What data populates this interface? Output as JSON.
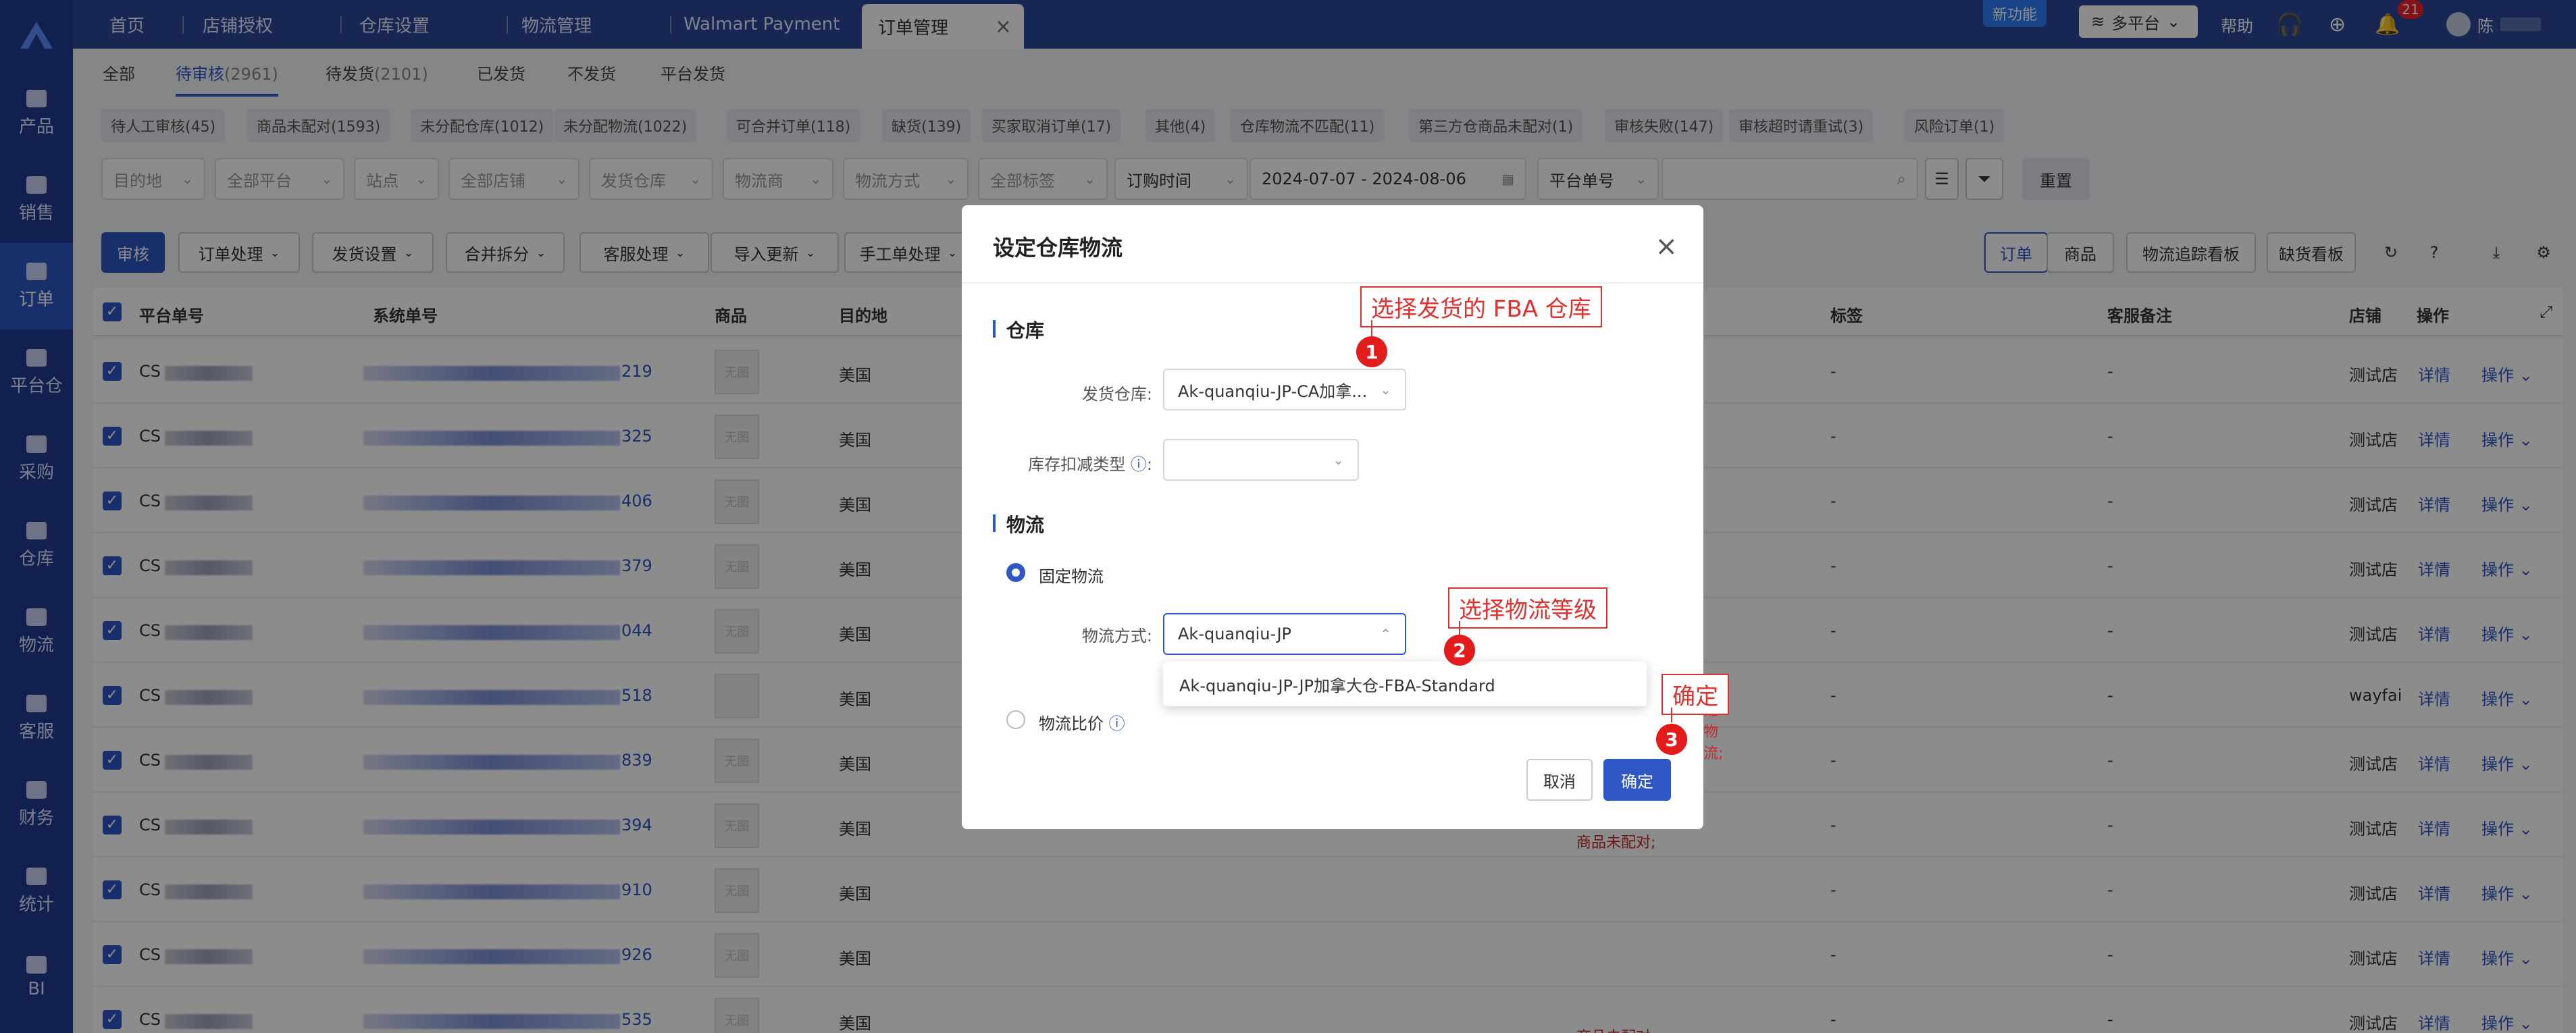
{
  "app": {
    "logo": "A"
  },
  "leftnav": [
    {
      "label": "产品"
    },
    {
      "label": "销售"
    },
    {
      "label": "订单",
      "active": true
    },
    {
      "label": "平台仓"
    },
    {
      "label": "采购"
    },
    {
      "label": "仓库"
    },
    {
      "label": "物流"
    },
    {
      "label": "客服"
    },
    {
      "label": "财务"
    },
    {
      "label": "统计"
    },
    {
      "label": "BI"
    }
  ],
  "topbar": {
    "tabs": [
      "首页",
      "店铺授权",
      "仓库设置",
      "物流管理",
      "Walmart Payment",
      "订单管理"
    ],
    "active_tab_close": "×",
    "new_feature": "新功能",
    "platform": "多平台",
    "help": "帮助",
    "notification_count": "21",
    "user": "陈"
  },
  "subtabs": [
    "全部",
    "待审核",
    "(2961)",
    "待发货",
    "(2101)",
    "已发货",
    "不发货",
    "平台发货"
  ],
  "chips": [
    "待人工审核(45)",
    "商品未配对(1593)",
    "未分配仓库(1012)",
    "未分配物流(1022)",
    "可合并订单(118)",
    "缺货(139)",
    "买家取消订单(17)",
    "其他(4)",
    "仓库物流不匹配(11)",
    "第三方仓商品未配对(1)",
    "审核失败(147)",
    "审核超时请重试(3)",
    "风险订单(1)"
  ],
  "filters": [
    "目的地",
    "全部平台",
    "站点",
    "全部店铺",
    "发货仓库",
    "物流商",
    "物流方式",
    "全部标签",
    "订购时间",
    "2024-07-07 - 2024-08-06",
    "平台单号"
  ],
  "filter_reset": "重置",
  "toolbar": [
    "审核",
    "订单处理",
    "发货设置",
    "合并拆分",
    "客服处理",
    "导入更新",
    "手工单处理"
  ],
  "toolbar_right": [
    "订单",
    "商品",
    "物流追踪看板",
    "缺货看板"
  ],
  "table": {
    "headers": [
      "平台单号",
      "系统单号",
      "商品",
      "目的地",
      "标签",
      "客服备注",
      "店铺",
      "操作"
    ],
    "rows": [
      {
        "pno": "CS",
        "sno": "219",
        "dest": "美国",
        "thumb": "无图",
        "tag": "-",
        "note": "-",
        "shop": "测试店",
        "detail": "详情",
        "op": "操作"
      },
      {
        "pno": "CS",
        "sno": "325",
        "dest": "美国",
        "thumb": "无图",
        "tag": "-",
        "note": "-",
        "shop": "测试店",
        "detail": "详情",
        "op": "操作"
      },
      {
        "pno": "CS",
        "sno": "406",
        "dest": "美国",
        "thumb": "无图",
        "tag": "-",
        "note": "-",
        "shop": "测试店",
        "detail": "详情",
        "op": "操作"
      },
      {
        "pno": "CS",
        "sno": "379",
        "dest": "美国",
        "thumb": "无图",
        "tag": "-",
        "note": "-",
        "shop": "测试店",
        "detail": "详情",
        "op": "操作"
      },
      {
        "pno": "CS",
        "sno": "044",
        "dest": "美国",
        "thumb": "无图",
        "tag": "-",
        "note": "-",
        "shop": "测试店",
        "detail": "详情",
        "op": "操作"
      },
      {
        "pno": "CS",
        "sno": "518",
        "dest": "美国",
        "thumb": "",
        "tag": "-",
        "note": "-",
        "shop": "wayfai",
        "detail": "详情",
        "op": "操作"
      },
      {
        "pno": "CS",
        "sno": "839",
        "dest": "美国",
        "thumb": "无图",
        "tag": "-",
        "note": "-",
        "shop": "测试店",
        "detail": "详情",
        "op": "操作"
      },
      {
        "pno": "CS",
        "sno": "394",
        "dest": "美国",
        "thumb": "无图",
        "tag": "-",
        "note": "-",
        "shop": "测试店",
        "detail": "详情",
        "op": "操作",
        "status": "商品未配对;"
      },
      {
        "pno": "CS",
        "sno": "910",
        "dest": "美国",
        "thumb": "无图",
        "tag": "-",
        "note": "-",
        "shop": "测试店",
        "detail": "详情",
        "op": "操作"
      },
      {
        "pno": "CS",
        "sno": "926",
        "dest": "美国",
        "thumb": "无图",
        "tag": "-",
        "note": "-",
        "shop": "测试店",
        "detail": "详情",
        "op": "操作"
      },
      {
        "pno": "CS",
        "sno": "535",
        "dest": "美国",
        "thumb": "无图",
        "tag": "-",
        "note": "-",
        "shop": "测试店",
        "detail": "详情",
        "op": "操作",
        "status": "商品未配对;"
      }
    ]
  },
  "modal": {
    "title": "设定仓库物流",
    "close": "×",
    "section_warehouse": "仓库",
    "ship_wh_label": "发货仓库:",
    "ship_wh_value": "Ak-quanqiu-JP-CA加拿...",
    "stock_type_label": "库存扣减类型",
    "section_logistics": "物流",
    "fixed_logistics": "固定物流",
    "method_label": "物流方式:",
    "method_value": "Ak-quanqiu-JP",
    "dropdown_option": "Ak-quanqiu-JP-JP加拿大仓-FBA-Standard",
    "ratio_logistics": "物流比价",
    "cancel": "取消",
    "ok": "确定",
    "behind_text": "配物流;"
  },
  "annotations": {
    "a1": "选择发货的 FBA 仓库",
    "a2": "选择物流等级",
    "a3": "确定",
    "n1": "1",
    "n2": "2",
    "n3": "3"
  }
}
